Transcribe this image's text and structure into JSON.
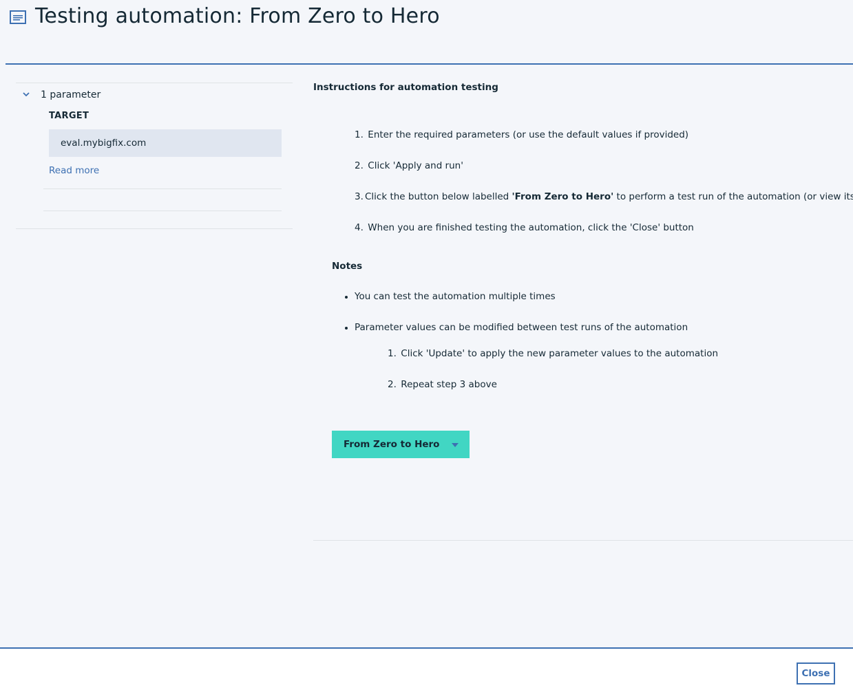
{
  "header": {
    "title": "Testing automation: From Zero to Hero",
    "icon": "document-icon"
  },
  "parameters": {
    "count_label": "1 parameter",
    "items": [
      {
        "label": "TARGET",
        "value": "eval.mybigfix.com"
      }
    ],
    "read_more": "Read more"
  },
  "instructions": {
    "title": "Instructions for automation testing",
    "steps": [
      {
        "num": "1.",
        "text": "Enter the required parameters (or use the default values if provided)"
      },
      {
        "num": "2.",
        "text": "Click 'Apply and run'"
      },
      {
        "num": "3.",
        "pre": "Click the button below labelled ",
        "bold": "'From Zero to Hero'",
        "post": " to perform a test run of the automation (or view its details)"
      },
      {
        "num": "4.",
        "text": "When you are finished testing the automation, click the 'Close' button"
      }
    ],
    "notes_title": "Notes",
    "notes": [
      "You can test the automation multiple times",
      "Parameter values can be modified between test runs of the automation"
    ],
    "substeps": [
      {
        "num": "1.",
        "text": "Click 'Update' to apply the new parameter values to the automation"
      },
      {
        "num": "2.",
        "text": "Repeat step 3 above"
      }
    ]
  },
  "run_button": {
    "label": "From Zero to Hero"
  },
  "footer": {
    "close_label": "Close"
  },
  "colors": {
    "accent": "#3d70b2",
    "run_button": "#41d6c3",
    "background": "#f4f6fa"
  }
}
